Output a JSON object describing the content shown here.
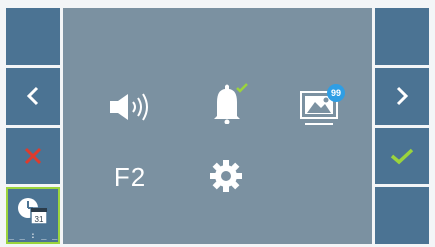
{
  "left_bar": {
    "buttons": [
      "blank",
      "previous",
      "cancel",
      "datetime"
    ],
    "datetime": {
      "day": "31",
      "placeholder": "_ _ : _ _"
    }
  },
  "right_bar": {
    "buttons": [
      "blank",
      "next",
      "confirm",
      "blank"
    ]
  },
  "menu": {
    "f2_label": "F2",
    "gallery_badge": "99",
    "icons": [
      "speaker-volume-icon",
      "bell-icon",
      "gallery-icon",
      "f2-label",
      "gear-icon"
    ]
  },
  "colors": {
    "panel": "#4b7393",
    "center": "#7b91a1",
    "cancel": "#e03b2c",
    "confirm": "#9bd43c",
    "badge": "#2f9ee4"
  }
}
